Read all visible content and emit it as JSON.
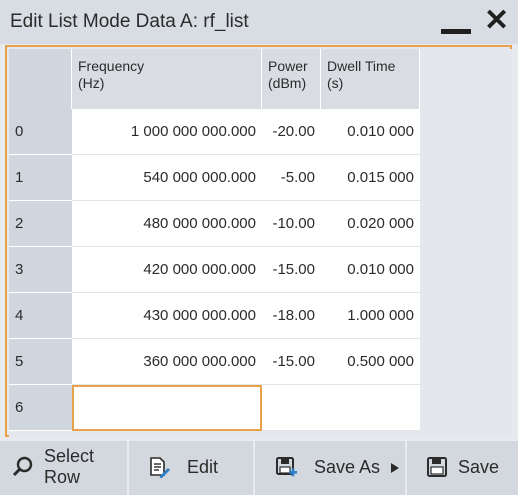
{
  "dialog": {
    "title": "Edit List Mode Data A: rf_list",
    "close_glyph": "✕"
  },
  "table": {
    "headers": {
      "frequency": "Frequency\n(Hz)",
      "power": "Power\n(dBm)",
      "dwell": "Dwell Time\n(s)"
    },
    "rows": [
      {
        "index": "0",
        "frequency": "1 000 000 000.000",
        "power": "-20.00",
        "dwell": "0.010 000"
      },
      {
        "index": "1",
        "frequency": "540 000 000.000",
        "power": "-5.00",
        "dwell": "0.015 000"
      },
      {
        "index": "2",
        "frequency": "480 000 000.000",
        "power": "-10.00",
        "dwell": "0.020 000"
      },
      {
        "index": "3",
        "frequency": "420 000 000.000",
        "power": "-15.00",
        "dwell": "0.010 000"
      },
      {
        "index": "4",
        "frequency": "430 000 000.000",
        "power": "-18.00",
        "dwell": "1.000 000"
      },
      {
        "index": "5",
        "frequency": "360 000 000.000",
        "power": "-15.00",
        "dwell": "0.500 000"
      },
      {
        "index": "6",
        "frequency": "",
        "power": "",
        "dwell": ""
      }
    ]
  },
  "toolbar": {
    "select_row": "Select\nRow",
    "edit": "Edit",
    "save_as": "Save As",
    "save": "Save"
  },
  "icons": {
    "select_row": "search-icon",
    "edit": "edit-document-icon",
    "save_as": "save-as-icon",
    "save": "save-icon",
    "submenu": "triangle-right-icon"
  },
  "colors": {
    "accent": "#e8a24a",
    "titlebar": "#d7dde3"
  }
}
